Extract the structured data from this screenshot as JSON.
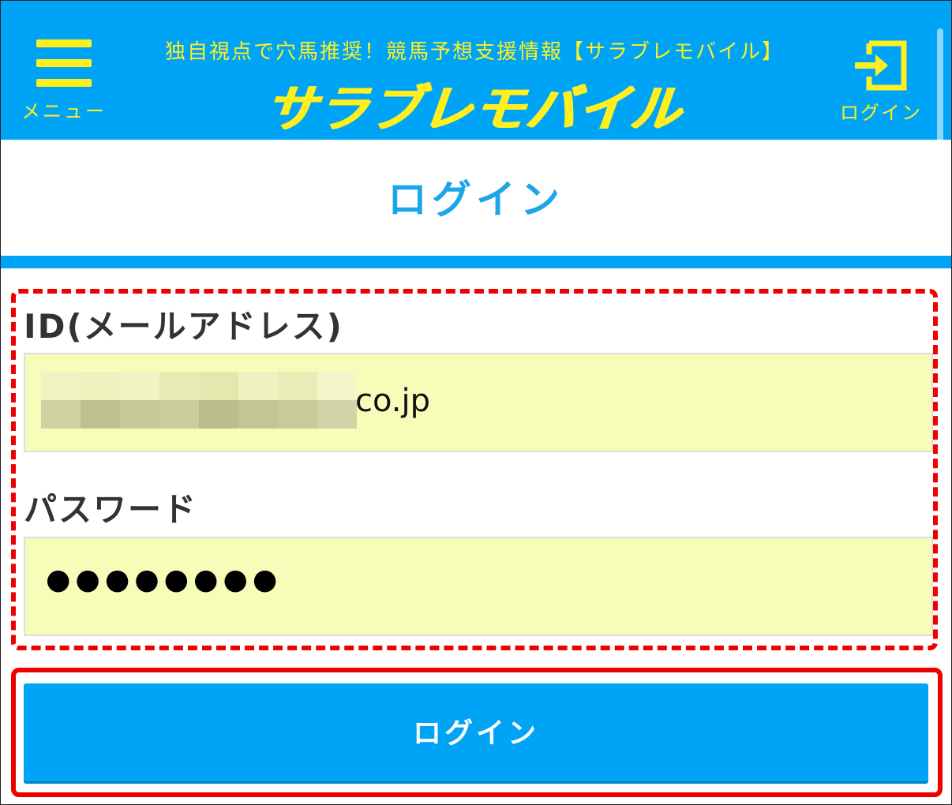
{
  "header": {
    "tagline": "独自視点で穴馬推奨！競馬予想支援情報【サラブレモバイル】",
    "brand": "サラブレモバイル",
    "menu_label": "メニュー",
    "login_label": "ログイン"
  },
  "page": {
    "title": "ログイン"
  },
  "form": {
    "id_label": "ID(メールアドレス)",
    "id_value_visible": "co.jp",
    "password_label": "パスワード",
    "password_value": "●●●●●●●●",
    "submit_label": "ログイン"
  },
  "colors": {
    "header_bg": "#00a4f7",
    "header_text": "#ffef1f",
    "title_text": "#1ba6ea",
    "input_bg": "#f8fcb9",
    "highlight": "#ee0000"
  },
  "icons": {
    "menu": "hamburger-icon",
    "login": "login-arrow-icon"
  }
}
